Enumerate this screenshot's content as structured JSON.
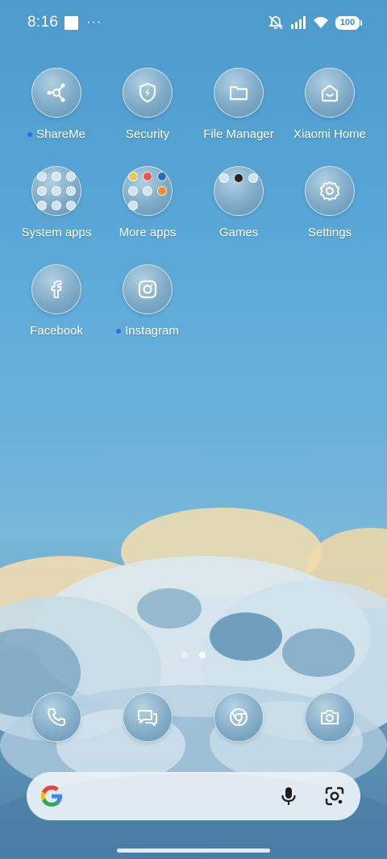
{
  "status_bar": {
    "time": "8:16",
    "more": "···",
    "battery": "100",
    "icons": [
      "notification-square-icon",
      "mute-vibrate-icon",
      "signal-icon",
      "wifi-icon",
      "battery-icon"
    ]
  },
  "apps": [
    {
      "label": "ShareMe",
      "icon": "share-icon",
      "new": true
    },
    {
      "label": "Security",
      "icon": "shield-bolt-icon",
      "new": false
    },
    {
      "label": "File Manager",
      "icon": "folder-icon",
      "new": false
    },
    {
      "label": "Xiaomi Home",
      "icon": "home-smile-icon",
      "new": false
    },
    {
      "label": "System apps",
      "icon": "folder-icon",
      "new": false
    },
    {
      "label": "More apps",
      "icon": "folder-icon",
      "new": false
    },
    {
      "label": "Games",
      "icon": "folder-icon",
      "new": false
    },
    {
      "label": "Settings",
      "icon": "gear-icon",
      "new": false
    },
    {
      "label": "Facebook",
      "icon": "facebook-icon",
      "new": false
    },
    {
      "label": "Instagram",
      "icon": "instagram-icon",
      "new": true
    }
  ],
  "pages": {
    "count": 2,
    "active": 2
  },
  "dock": [
    {
      "icon": "phone-icon"
    },
    {
      "icon": "messages-icon"
    },
    {
      "icon": "chrome-icon"
    },
    {
      "icon": "camera-icon"
    }
  ],
  "search": {
    "logo": "google-logo",
    "icons": [
      "microphone-icon",
      "lens-icon"
    ]
  },
  "colors": {
    "new_dot": "#2f6cf0",
    "sky_top": "#4d9bcc",
    "search_bg": "#eaf0f6"
  }
}
